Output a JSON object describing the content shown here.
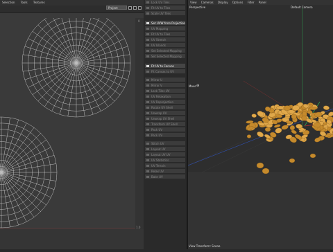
{
  "uv_editor": {
    "menu": [
      "Selection",
      "Tools",
      "Textures"
    ],
    "project_select": "Project",
    "ruler_top_right": "0",
    "ruler_bottom_right": "1.0"
  },
  "uv_commands": {
    "items": [
      {
        "label": "Lock UV Tiles",
        "active": false
      },
      {
        "label": "Fit UV to Tiles",
        "active": false
      },
      {
        "label": "Scale UV Tiles",
        "active": false
      },
      {
        "label": "Set UVW from Projection",
        "active": true
      },
      {
        "label": "UV Mapping",
        "active": false
      },
      {
        "label": "Fit UV to Tiles",
        "active": false
      },
      {
        "label": "UV Stretch",
        "active": false
      },
      {
        "label": "UV Islands",
        "active": false
      },
      {
        "label": "Set Selected Mapping",
        "active": false
      },
      {
        "label": "Set Selected Mapping",
        "active": false
      },
      {
        "label": "Fit UV to Canvas",
        "active": true
      },
      {
        "label": "Fit Canvas to UV",
        "active": false
      },
      {
        "label": "Mirror U",
        "active": false
      },
      {
        "label": "Mirror V",
        "active": false
      },
      {
        "label": "Lock Tiles UV",
        "active": false
      },
      {
        "label": "UV Relaxation",
        "active": false
      },
      {
        "label": "UV Reprojection",
        "active": false
      },
      {
        "label": "Rotate UV Shell",
        "active": false
      },
      {
        "label": "Unwrap UV",
        "active": false
      },
      {
        "label": "Unwrap UV Shell",
        "active": false
      },
      {
        "label": "Transform UV Shell",
        "active": false
      },
      {
        "label": "Pack UV",
        "active": false
      },
      {
        "label": "Pack UV",
        "active": false
      },
      {
        "label": "Stitch UV",
        "active": false
      },
      {
        "label": "Layout UV",
        "active": false
      },
      {
        "label": "Layout UV UV",
        "active": false
      },
      {
        "label": "UV Statistics",
        "active": false
      },
      {
        "label": "UV Terrain",
        "active": false
      },
      {
        "label": "Relax UV",
        "active": false
      },
      {
        "label": "Bake UV",
        "active": false
      }
    ]
  },
  "viewport": {
    "menu": [
      "View",
      "Cameras",
      "Display",
      "Options",
      "Filter",
      "Panel"
    ],
    "view_name": "Perspective",
    "camera_name": "Default Camera",
    "mode_label": "Move",
    "footer": "View Transform: Scene"
  },
  "colors": {
    "coin": "#c58a2c",
    "coin_light": "#e0a84a",
    "grid_line": "#d8d8d8",
    "accent_red": "#b03030",
    "accent_green": "#30a050",
    "accent_blue": "#3050b0"
  }
}
